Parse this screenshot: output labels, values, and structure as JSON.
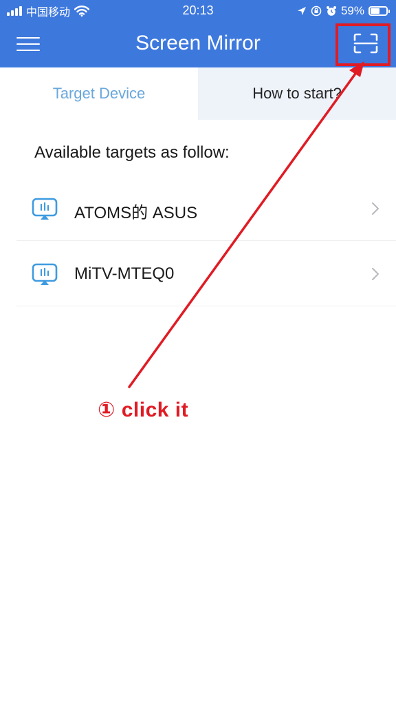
{
  "status_bar": {
    "carrier": "中国移动",
    "time": "20:13",
    "battery_percent": "59%",
    "battery_level": 0.59,
    "icons": [
      "signal-icon",
      "wifi-icon",
      "location-icon",
      "lock-rotation-icon",
      "alarm-icon",
      "battery-icon"
    ]
  },
  "header": {
    "title": "Screen Mirror",
    "left_icon": "menu-icon",
    "right_icon": "scan-icon",
    "background_color": "#3d78dd"
  },
  "tabs": [
    {
      "label": "Target Device",
      "selected": true
    },
    {
      "label": "How to start?",
      "selected": false
    }
  ],
  "content": {
    "heading": "Available targets as follow:",
    "devices": [
      {
        "name": "ATOMS的 ASUS",
        "icon": "screen-cast-icon"
      },
      {
        "name": "MiTV-MTEQ0",
        "icon": "screen-cast-icon"
      }
    ]
  },
  "annotation": {
    "text": "① click it",
    "color": "#e01b24"
  }
}
